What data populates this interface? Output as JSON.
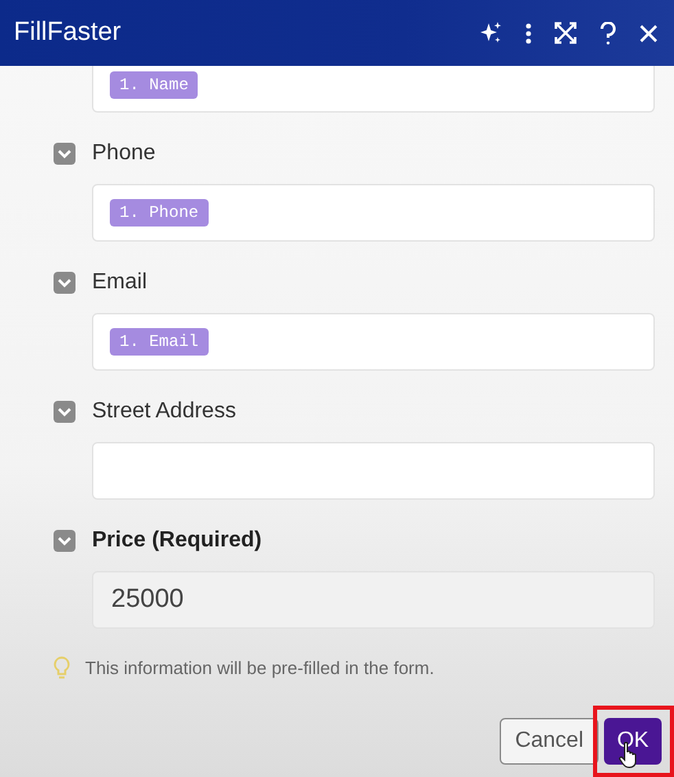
{
  "window": {
    "title": "FillFaster"
  },
  "fields": [
    {
      "kind": "chip",
      "value": "1. Name"
    },
    {
      "label": "Phone",
      "kind": "chip",
      "value": "1. Phone",
      "required": false,
      "expanded": true
    },
    {
      "label": "Email",
      "kind": "chip",
      "value": "1. Email",
      "required": false,
      "expanded": true
    },
    {
      "label": "Street Address",
      "kind": "text",
      "required": false,
      "expanded": true
    },
    {
      "label": "Price (Required)",
      "kind": "text",
      "value": "25000",
      "required": true,
      "expanded": true
    }
  ],
  "hint": "This information will be pre-filled in the form.",
  "buttons": [
    {
      "label": "Cancel",
      "kind": "secondary"
    },
    {
      "label": "OK",
      "kind": "primary",
      "highlighted": true
    }
  ]
}
